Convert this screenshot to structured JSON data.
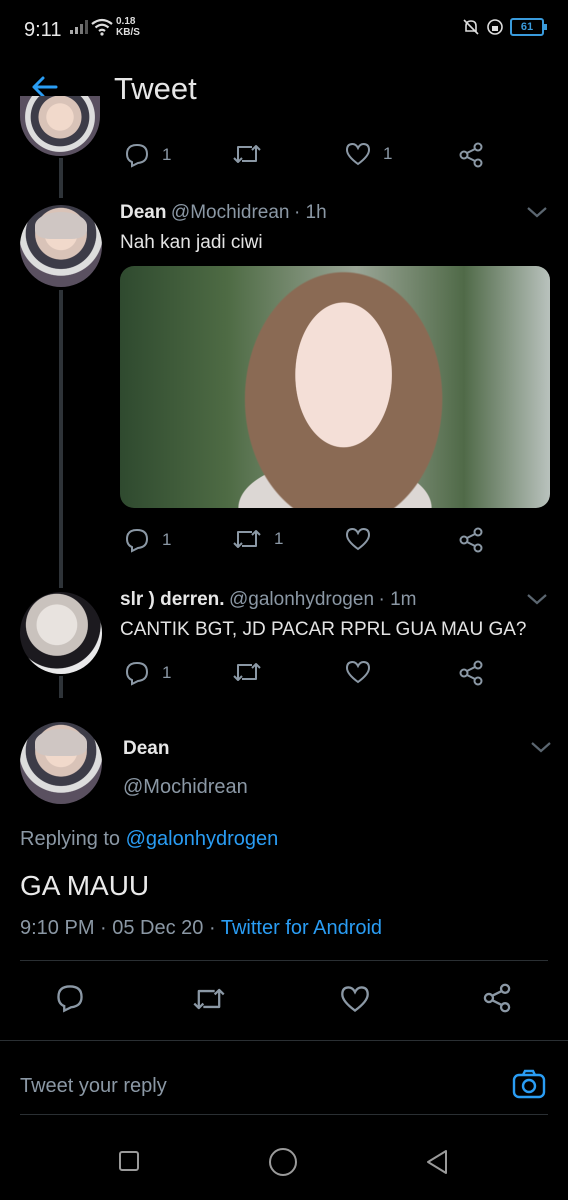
{
  "status_bar": {
    "time": "9:11",
    "speed_value": "0.18",
    "speed_unit": "KB/S",
    "battery": "61"
  },
  "header": {
    "title": "Tweet"
  },
  "top_tweet_actions": {
    "replies": "1",
    "likes": "1"
  },
  "tweet1": {
    "name": "Dean",
    "handle": "@Mochidrean",
    "time": "· 1h",
    "text": "Nah kan jadi ciwi",
    "replies": "1",
    "retweets": "1"
  },
  "tweet2": {
    "name": "slr ) derren.",
    "handle": "@galonhydrogen",
    "time": "· 1m",
    "text": "CANTIK BGT, JD PACAR RPRL GUA MAU GA?",
    "replies": "1"
  },
  "main_tweet": {
    "name": "Dean",
    "handle": "@Mochidrean",
    "replying_prefix": "Replying to",
    "replying_to": "@galonhydrogen",
    "text": "GA MAUU",
    "timestamp": "9:10 PM · 05 Dec 20 ·",
    "client": "Twitter for Android"
  },
  "reply_box": {
    "placeholder": "Tweet your reply"
  },
  "icons": {
    "reply": "reply-icon",
    "retweet": "retweet-icon",
    "like": "heart-icon",
    "share": "share-icon",
    "back": "back-arrow-icon",
    "camera": "camera-icon"
  },
  "colors": {
    "accent": "#2a9df4",
    "muted": "#8b98a5",
    "background": "#000000"
  }
}
